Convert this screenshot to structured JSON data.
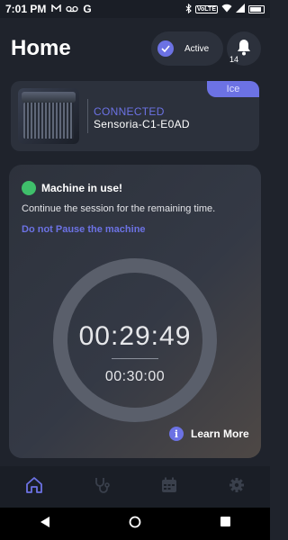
{
  "status_bar": {
    "time": "7:01 PM",
    "left_icons": [
      "notification-m-icon",
      "voicemail-icon",
      "google-g-icon"
    ],
    "g_label": "G",
    "right_icons": [
      "bluetooth-icon",
      "volte-icon",
      "wifi-icon",
      "signal-icon",
      "battery-icon"
    ],
    "volte_label": "VoLTE"
  },
  "header": {
    "title": "Home",
    "status_pill": {
      "label": "Active"
    },
    "notifications": {
      "count": "14"
    }
  },
  "device_card": {
    "status": "CONNECTED",
    "name": "Sensoria-C1-E0AD",
    "tag": "Ice"
  },
  "session_card": {
    "title": "Machine in use!",
    "description": "Continue the session for the remaining time.",
    "pause_link": "Do not Pause the machine",
    "timer": {
      "elapsed": "00:29:49",
      "total": "00:30:00"
    },
    "learn_more": "Learn More"
  },
  "bottom_nav": {
    "items": [
      {
        "icon": "home-icon",
        "active": true
      },
      {
        "icon": "stethoscope-icon",
        "active": false
      },
      {
        "icon": "calendar-icon",
        "active": false
      },
      {
        "icon": "settings-icon",
        "active": false
      }
    ]
  },
  "colors": {
    "background": "#1f232c",
    "card": "#2c313c",
    "accent": "#6c72e4",
    "success": "#3fbf6b",
    "nav_bar": "#1a1e26"
  }
}
